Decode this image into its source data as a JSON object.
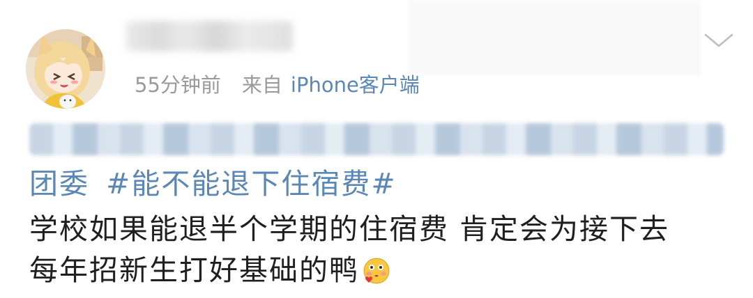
{
  "post": {
    "author": {
      "avatar_icon": "anime-girl-avatar",
      "username_blurred": true
    },
    "meta": {
      "time": "55分钟前",
      "source_prefix": "来自",
      "client": "iPhone客户端"
    },
    "content": {
      "mention_blurred": true,
      "topic_line_org": "团委",
      "topic_tag": "#能不能退下住宿费#",
      "body_line1": "学校如果能退半个学期的住宿费 肯定会为接下去",
      "body_line2": "每年招新生打好基础的鸭",
      "emoji_icon": "blushing-kiss-emoji"
    },
    "more_icon": "chevron-down-icon"
  },
  "colors": {
    "link": "#5a87b4",
    "meta_gray": "#9a9a9a",
    "body_text": "#1f1f1f"
  }
}
